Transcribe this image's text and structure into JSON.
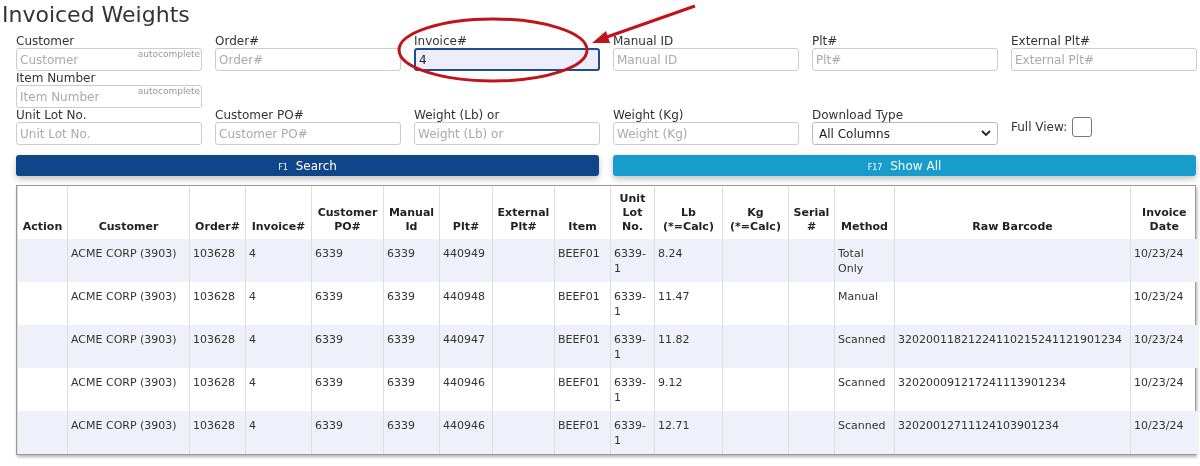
{
  "title": "Invoiced Weights",
  "field_rows": [
    [
      {
        "kind": "text",
        "label": "Customer",
        "placeholder": "Customer",
        "hint": "autocomplete",
        "focused": false
      },
      {
        "kind": "text",
        "label": "Order#",
        "placeholder": "Order#",
        "focused": false
      },
      {
        "kind": "text",
        "label": "Invoice#",
        "value": "4",
        "focused": true
      },
      {
        "kind": "text",
        "label": "Manual ID",
        "placeholder": "Manual ID",
        "focused": false
      },
      {
        "kind": "text",
        "label": "Plt#",
        "placeholder": "Plt#",
        "focused": false
      },
      {
        "kind": "text",
        "label": "External Plt#",
        "placeholder": "External Plt#",
        "focused": false
      }
    ],
    [
      {
        "kind": "text",
        "label": "Item Number",
        "placeholder": "Item Number",
        "hint": "autocomplete",
        "focused": false
      }
    ],
    [
      {
        "kind": "text",
        "label": "Unit Lot No.",
        "placeholder": "Unit Lot No.",
        "focused": false
      },
      {
        "kind": "text",
        "label": "Customer PO#",
        "placeholder": "Customer PO#",
        "focused": false
      },
      {
        "kind": "text",
        "label": "Weight (Lb) or",
        "placeholder": "Weight (Lb) or",
        "focused": false
      },
      {
        "kind": "text",
        "label": "Weight (Kg)",
        "placeholder": "Weight (Kg)",
        "focused": false
      },
      {
        "kind": "select",
        "label": "Download Type",
        "value": "All Columns"
      },
      {
        "kind": "checkbox",
        "label": "Full View:",
        "checked": false
      }
    ]
  ],
  "buttons": [
    {
      "kind": "primary",
      "key": "F1",
      "label": "Search"
    },
    {
      "kind": "secondary",
      "key": "F17",
      "label": "Show All"
    }
  ],
  "table": {
    "columns": [
      "Action",
      "Customer",
      "Order#",
      "Invoice#",
      "Customer PO#",
      "Manual Id",
      "Plt#",
      "External Plt#",
      "Item",
      "Unit Lot No.",
      "Lb (*=Calc)",
      "Kg (*=Calc)",
      "Serial #",
      "Method",
      "Raw Barcode",
      "Invoice Date"
    ],
    "rows": [
      [
        "",
        "ACME CORP (3903)",
        "103628",
        "4",
        "6339",
        "6339",
        "440949",
        "",
        "BEEF01",
        "6339-1",
        "8.24",
        "",
        "",
        "Total Only",
        "",
        "10/23/24"
      ],
      [
        "",
        "ACME CORP (3903)",
        "103628",
        "4",
        "6339",
        "6339",
        "440948",
        "",
        "BEEF01",
        "6339-1",
        "11.47",
        "",
        "",
        "Manual",
        "",
        "10/23/24"
      ],
      [
        "",
        "ACME CORP (3903)",
        "103628",
        "4",
        "6339",
        "6339",
        "440947",
        "",
        "BEEF01",
        "6339-1",
        "11.82",
        "",
        "",
        "Scanned",
        "32020011821224110215241121901234",
        "10/23/24"
      ],
      [
        "",
        "ACME CORP (3903)",
        "103628",
        "4",
        "6339",
        "6339",
        "440946",
        "",
        "BEEF01",
        "6339-1",
        "9.12",
        "",
        "",
        "Scanned",
        "320200091217241113901234",
        "10/23/24"
      ],
      [
        "",
        "ACME CORP (3903)",
        "103628",
        "4",
        "6339",
        "6339",
        "440946",
        "",
        "BEEF01",
        "6339-1",
        "12.71",
        "",
        "",
        "Scanned",
        "32020012711124103901234",
        "10/23/24"
      ]
    ]
  }
}
